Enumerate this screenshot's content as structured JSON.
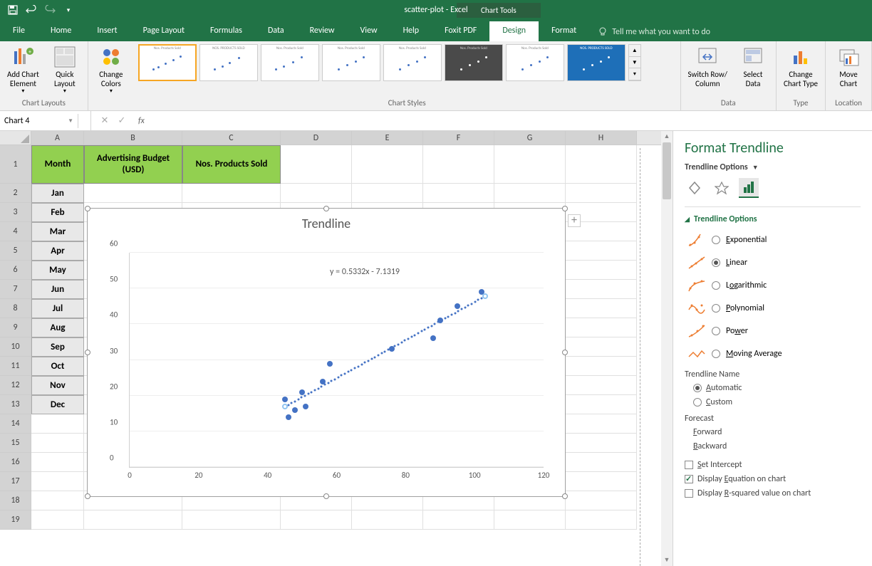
{
  "titlebar": {
    "chart_tools": "Chart Tools",
    "doc_title": "scatter-plot - Excel"
  },
  "tabs": {
    "file": "File",
    "home": "Home",
    "insert": "Insert",
    "page_layout": "Page Layout",
    "formulas": "Formulas",
    "data": "Data",
    "review": "Review",
    "view": "View",
    "help": "Help",
    "foxit": "Foxit PDF",
    "design": "Design",
    "format": "Format",
    "tell_me": "Tell me what you want to do"
  },
  "ribbon": {
    "add_chart_element": "Add Chart\nElement",
    "quick_layout": "Quick\nLayout",
    "change_colors": "Change\nColors",
    "switch_row_col": "Switch Row/\nColumn",
    "select_data": "Select\nData",
    "change_chart_type": "Change\nChart Type",
    "move_chart": "Move\nChart",
    "group_chart_layouts": "Chart Layouts",
    "group_chart_styles": "Chart Styles",
    "group_data": "Data",
    "group_type": "Type",
    "group_location": "Location"
  },
  "formula_bar": {
    "name_box": "Chart 4",
    "formula": ""
  },
  "grid": {
    "columns": [
      "A",
      "B",
      "C",
      "D",
      "E",
      "F",
      "G",
      "H"
    ],
    "header_row": {
      "a": "Month",
      "b": "Advertising Budget (USD)",
      "c": "Nos. Products Sold"
    },
    "months": [
      "Jan",
      "Feb",
      "Mar",
      "Apr",
      "May",
      "Jun",
      "Jul",
      "Aug",
      "Sep",
      "Oct",
      "Nov",
      "Dec"
    ]
  },
  "chart": {
    "title": "Trendline",
    "equation": "y = 0.5332x - 7.1319",
    "y_ticks": [
      "0",
      "10",
      "20",
      "30",
      "40",
      "50",
      "60"
    ],
    "x_ticks": [
      "0",
      "20",
      "40",
      "60",
      "80",
      "100",
      "120"
    ]
  },
  "chart_data": {
    "type": "scatter",
    "title": "Trendline",
    "xlabel": "",
    "ylabel": "",
    "xlim": [
      0,
      120
    ],
    "ylim": [
      0,
      60
    ],
    "series": [
      {
        "name": "Nos. Products Sold",
        "x": [
          45,
          46,
          48,
          50,
          51,
          56,
          58,
          76,
          88,
          90,
          95,
          102
        ],
        "y": [
          19,
          14,
          16,
          21,
          17,
          24,
          29,
          33,
          36,
          41,
          45,
          49
        ]
      }
    ],
    "trendline": {
      "type": "linear",
      "equation": "y = 0.5332x - 7.1319",
      "slope": 0.5332,
      "intercept": -7.1319
    }
  },
  "pane": {
    "title": "Format Trendline",
    "subtitle": "Trendline Options",
    "section": "Trendline Options",
    "opts": {
      "exponential": "Exponential",
      "linear": "Linear",
      "logarithmic": "Logarithmic",
      "polynomial": "Polynomial",
      "power": "Power",
      "moving_avg": "Moving Average"
    },
    "trendline_name": "Trendline Name",
    "automatic": "Automatic",
    "custom": "Custom",
    "forecast": "Forecast",
    "forward": "Forward",
    "backward": "Backward",
    "set_intercept": "Set Intercept",
    "display_eq": "Display Equation on chart",
    "display_r2": "Display R-squared value on chart"
  }
}
